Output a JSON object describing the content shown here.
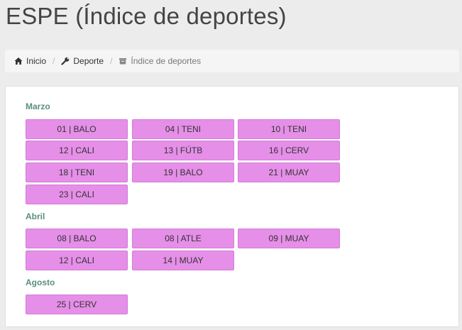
{
  "page": {
    "title": "ESPE (Índice de deportes)"
  },
  "breadcrumb": {
    "items": [
      {
        "label": "Inicio",
        "icon": "home-icon"
      },
      {
        "label": "Deporte",
        "icon": "wrench-icon"
      },
      {
        "label": "Índice de deportes",
        "icon": "archive-icon"
      }
    ],
    "separator": "/"
  },
  "colors": {
    "chip_bg": "#e58fe8",
    "month_label": "#5a8e7e"
  },
  "months": [
    {
      "label": "Marzo",
      "events": [
        "01 | BALO",
        "04 | TENI",
        "10 | TENI",
        "12 | CALI",
        "13 | FÚTB",
        "16 | CERV",
        "18 | TENI",
        "19 | BALO",
        "21 | MUAY",
        "23 | CALI"
      ]
    },
    {
      "label": "Abril",
      "events": [
        "08 | BALO",
        "08 | ATLE",
        "09 | MUAY",
        "12 | CALI",
        "14 | MUAY"
      ]
    },
    {
      "label": "Agosto",
      "events": [
        "25 | CERV"
      ]
    }
  ]
}
